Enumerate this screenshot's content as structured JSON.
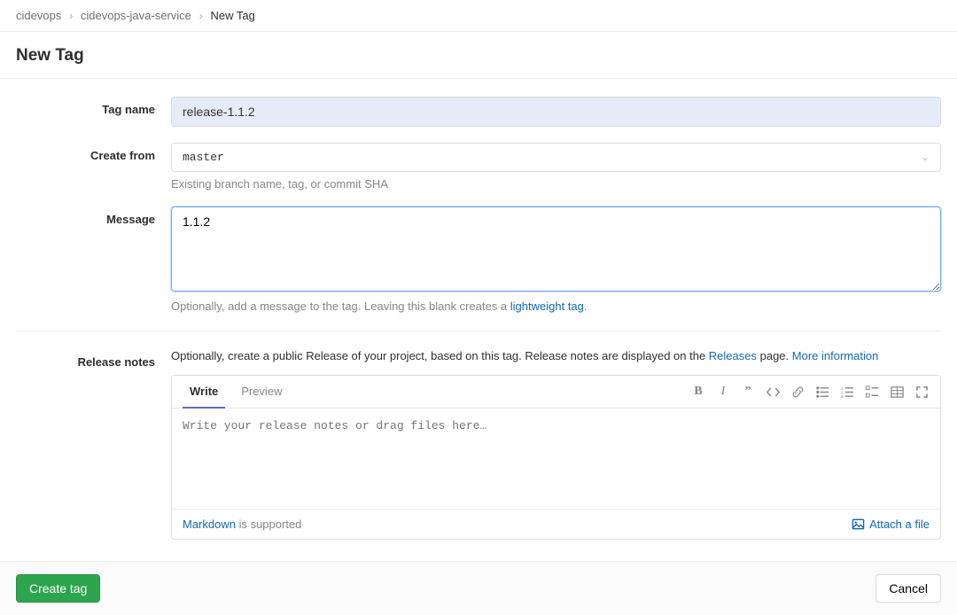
{
  "breadcrumb": {
    "items": [
      "cidevops",
      "cidevops-java-service"
    ],
    "current": "New Tag"
  },
  "page_title": "New Tag",
  "form": {
    "tag_name": {
      "label": "Tag name",
      "value": "release-1.1.2"
    },
    "create_from": {
      "label": "Create from",
      "value": "master",
      "help": "Existing branch name, tag, or commit SHA"
    },
    "message": {
      "label": "Message",
      "value": "1.1.2",
      "help_prefix": "Optionally, add a message to the tag. Leaving this blank creates a ",
      "help_link": "lightweight tag",
      "help_suffix": "."
    }
  },
  "release": {
    "label": "Release notes",
    "help_prefix": "Optionally, create a public Release of your project, based on this tag. Release notes are displayed on the ",
    "releases_link": "Releases",
    "help_mid": " page. ",
    "more_info": "More information",
    "tabs": {
      "write": "Write",
      "preview": "Preview"
    },
    "placeholder": "Write your release notes or drag files here…",
    "markdown_link": "Markdown",
    "markdown_rest": " is supported",
    "attach": "Attach a file"
  },
  "actions": {
    "create": "Create tag",
    "cancel": "Cancel"
  }
}
